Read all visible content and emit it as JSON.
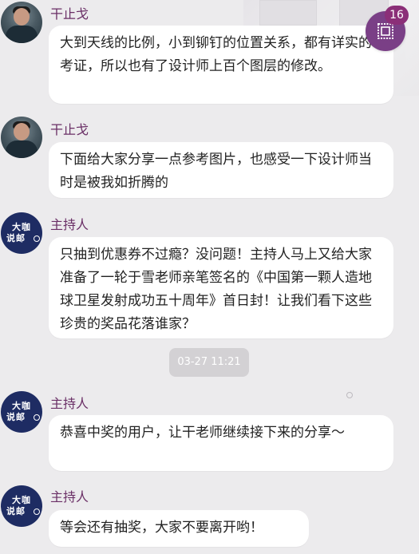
{
  "messages": [
    {
      "sender": "干止戈",
      "avatar": "host-photo-avatar",
      "text": "大到天线的比例，小到铆钉的位置关系，都有详实的考证，所以也有了设计师上百个图层的修改。"
    },
    {
      "sender": "干止戈",
      "avatar": "host-photo-avatar",
      "text": "下面给大家分享一点参考图片，也感受一下设计师当时是被我如折腾的"
    },
    {
      "sender": "主持人",
      "avatar": "dakashuobu-logo-avatar",
      "avatar_text_line1": "大咖",
      "avatar_text_line2": "说邮",
      "text": "只抽到优惠券不过瘾？没问题！主持人马上又给大家准备了一轮于雪老师亲笔签名的《中国第一颗人造地球卫星发射成功五十周年》首日封！让我们看下这些珍贵的奖品花落谁家？"
    },
    {
      "sender": "主持人",
      "avatar": "dakashuobu-logo-avatar",
      "avatar_text_line1": "大咖",
      "avatar_text_line2": "说邮",
      "text": "恭喜中奖的用户，让干老师继续接下来的分享～"
    },
    {
      "sender": "主持人",
      "avatar": "dakashuobu-logo-avatar",
      "avatar_text_line1": "大咖",
      "avatar_text_line2": "说邮",
      "text": "等会还有抽奖，大家不要离开哟！"
    }
  ],
  "timestamp": "03-27 11:21",
  "floating_button": {
    "icon": "stamp-icon",
    "badge_count": "16"
  },
  "colors": {
    "background": "#ecebed",
    "sender_name": "#6a2f66",
    "bubble": "#ffffff",
    "timestamp_bg": "#d3d1d4",
    "float_button": "#7a3f86",
    "badge": "#8b2f78",
    "host_avatar_bg": "#1e2c63"
  }
}
